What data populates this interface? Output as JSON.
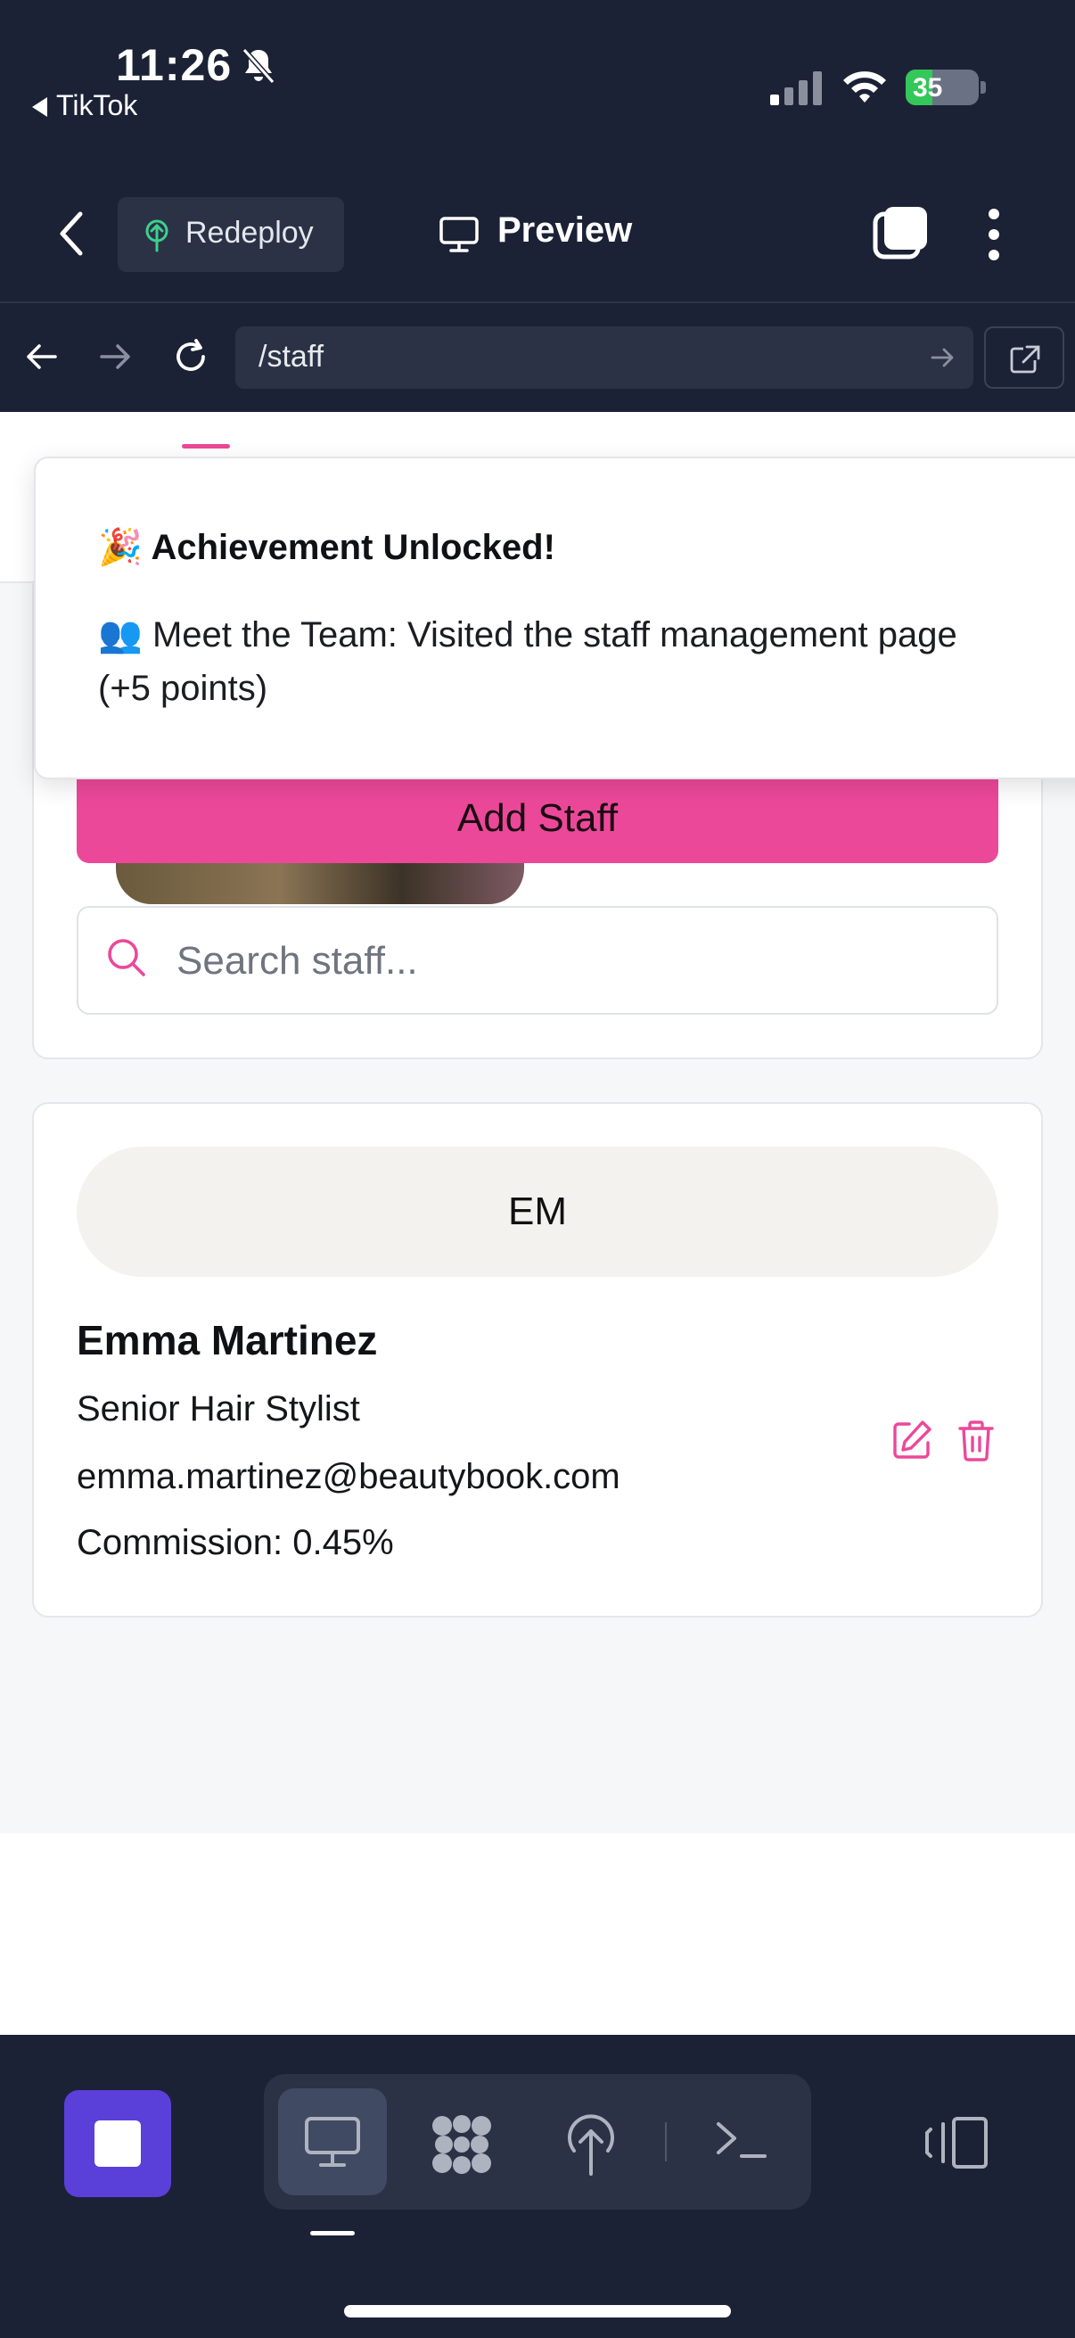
{
  "status_bar": {
    "time": "11:26",
    "back_app": "TikTok",
    "battery": "35"
  },
  "toolbar": {
    "redeploy_label": "Redeploy",
    "preview_label": "Preview"
  },
  "url_bar": {
    "path": "/staff"
  },
  "toast": {
    "title_emoji": "🎉",
    "title": "Achievement Unlocked!",
    "body_emoji": "👥",
    "body": "Meet the Team: Visited the staff management page (+5 points)"
  },
  "staff_page": {
    "add_staff_label": "Add Staff",
    "search_placeholder": "Search staff..."
  },
  "staff": [
    {
      "initials": "EM",
      "name": "Emma Martinez",
      "role": "Senior Hair Stylist",
      "email": "emma.martinez@beautybook.com",
      "commission": "Commission: 0.45%"
    }
  ],
  "colors": {
    "accent": "#ec4899",
    "app_bg": "#1c2235",
    "stop_button": "#5b3fd9"
  }
}
